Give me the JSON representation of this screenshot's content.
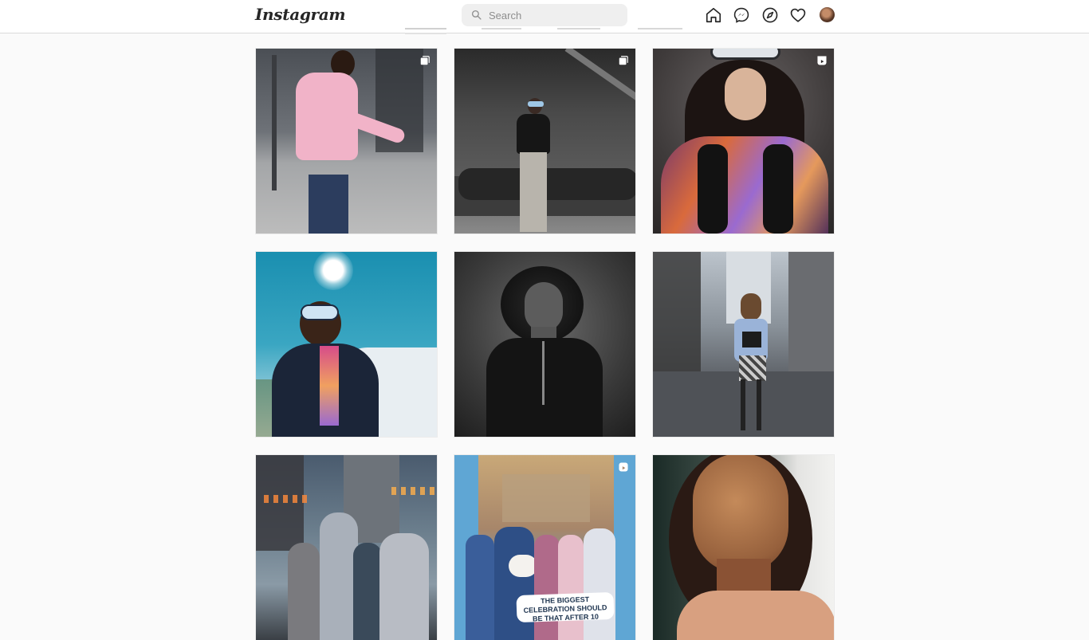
{
  "app": {
    "logo_text": "Instagram"
  },
  "search": {
    "placeholder": "Search",
    "value": ""
  },
  "nav": {
    "icons": [
      "home-icon",
      "messenger-icon",
      "explore-icon",
      "activity-heart-icon",
      "profile-avatar"
    ]
  },
  "posts": [
    {
      "row": 1,
      "col": 1,
      "media_type": "carousel",
      "media_icon": "carousel-icon"
    },
    {
      "row": 1,
      "col": 2,
      "media_type": "carousel",
      "media_icon": "carousel-icon"
    },
    {
      "row": 1,
      "col": 3,
      "media_type": "reel",
      "media_icon": "reel-icon"
    },
    {
      "row": 2,
      "col": 1,
      "media_type": "photo"
    },
    {
      "row": 2,
      "col": 2,
      "media_type": "photo"
    },
    {
      "row": 2,
      "col": 3,
      "media_type": "photo"
    },
    {
      "row": 3,
      "col": 1,
      "media_type": "photo"
    },
    {
      "row": 3,
      "col": 2,
      "media_type": "reel",
      "media_icon": "reel-icon",
      "caption_text": "THE BIGGEST CELEBRATION SHOULD BE THAT AFTER 10"
    },
    {
      "row": 3,
      "col": 3,
      "media_type": "photo"
    }
  ],
  "colors": {
    "accent": "#262626",
    "background": "#fafafa",
    "search_bg": "#efefef"
  }
}
